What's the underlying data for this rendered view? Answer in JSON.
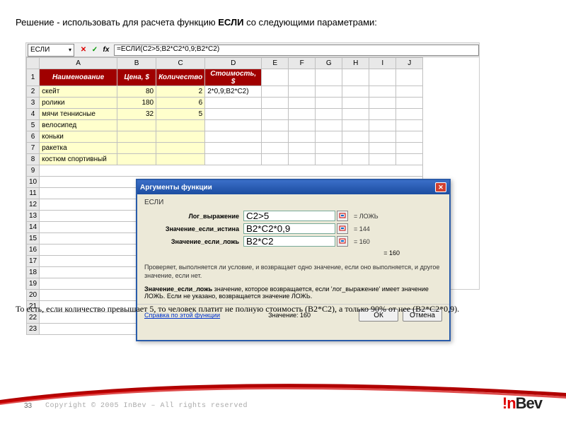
{
  "title_prefix": "Решение - использовать для расчета функцию ",
  "title_bold": "ЕСЛИ",
  "title_suffix": " со следующими параметрами:",
  "formula_bar": {
    "name_box": "ЕСЛИ",
    "formula": "=ЕСЛИ(C2>5;B2*C2*0,9;B2*C2)"
  },
  "columns": [
    "",
    "A",
    "B",
    "C",
    "D",
    "E",
    "F",
    "G",
    "H",
    "I",
    "J"
  ],
  "headers": [
    "Наименование",
    "Цена, $",
    "Количество",
    "Стоимость, $"
  ],
  "rows": [
    {
      "n": "1"
    },
    {
      "n": "2",
      "a": "скейт",
      "b": "80",
      "c": "2",
      "d": "2*0,9;B2*C2)"
    },
    {
      "n": "3",
      "a": "ролики",
      "b": "180",
      "c": "6",
      "d": ""
    },
    {
      "n": "4",
      "a": "мячи теннисные",
      "b": "32",
      "c": "5",
      "d": ""
    },
    {
      "n": "5",
      "a": "велосипед"
    },
    {
      "n": "6",
      "a": "коньки"
    },
    {
      "n": "7",
      "a": "ракетка"
    },
    {
      "n": "8",
      "a": "костюм спортивный"
    },
    {
      "n": "9"
    },
    {
      "n": "10"
    },
    {
      "n": "11"
    },
    {
      "n": "12"
    },
    {
      "n": "13"
    },
    {
      "n": "14"
    },
    {
      "n": "15"
    },
    {
      "n": "16"
    },
    {
      "n": "17"
    },
    {
      "n": "18"
    },
    {
      "n": "19"
    },
    {
      "n": "20"
    },
    {
      "n": "21"
    },
    {
      "n": "22"
    },
    {
      "n": "23"
    }
  ],
  "dialog": {
    "title": "Аргументы функции",
    "fn": "ЕСЛИ",
    "args": [
      {
        "label": "Лог_выражение",
        "value": "C2>5",
        "result": "= ЛОЖЬ"
      },
      {
        "label": "Значение_если_истина",
        "value": "B2*C2*0,9",
        "result": "= 144"
      },
      {
        "label": "Значение_если_ложь",
        "value": "B2*C2",
        "result": "= 160"
      }
    ],
    "eq_result": "= 160",
    "desc1": "Проверяет, выполняется ли условие, и возвращает одно значение, если оно выполняется, и другое значение, если нет.",
    "desc2_label": "Значение_если_ложь",
    "desc2_text": "значение, которое возвращается, если 'лог_выражение' имеет значение ЛОЖЬ. Если не указано, возвращается значение ЛОЖЬ.",
    "help_link": "Справка по этой функции",
    "value_label": "Значение: 160",
    "ok": "ОК",
    "cancel": "Отмена"
  },
  "bottom_text": "То есть, если количество превышает 5, то человек платит не полную стоимость (B2*C2), а только 90% от нее (B2*C2*0,9).",
  "page_num": "33",
  "copyright": "Copyright © 2005 InBev – All rights reserved",
  "logo_ex": "!n",
  "logo_rest": "Bev"
}
